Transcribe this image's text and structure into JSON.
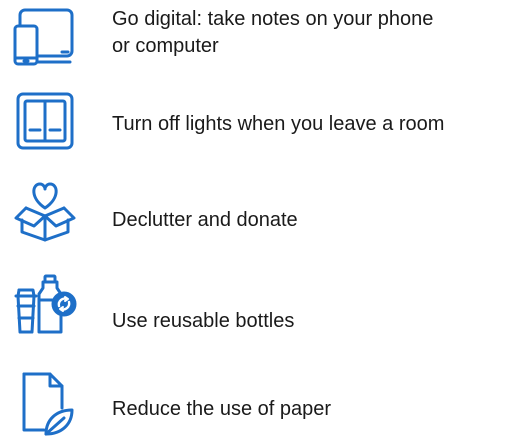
{
  "accent_color": "#1e6fc8",
  "tips": [
    {
      "icon": "devices-icon",
      "lines": [
        "Go digital: take notes on your phone",
        "or computer"
      ]
    },
    {
      "icon": "light-switch-icon",
      "lines": [
        "Turn off lights when you leave a room"
      ]
    },
    {
      "icon": "heart-box-icon",
      "lines": [
        "Declutter and donate"
      ]
    },
    {
      "icon": "reusable-bottles-icon",
      "lines": [
        "Use reusable bottles"
      ]
    },
    {
      "icon": "paper-leaf-icon",
      "lines": [
        "Reduce the use of paper"
      ]
    }
  ]
}
